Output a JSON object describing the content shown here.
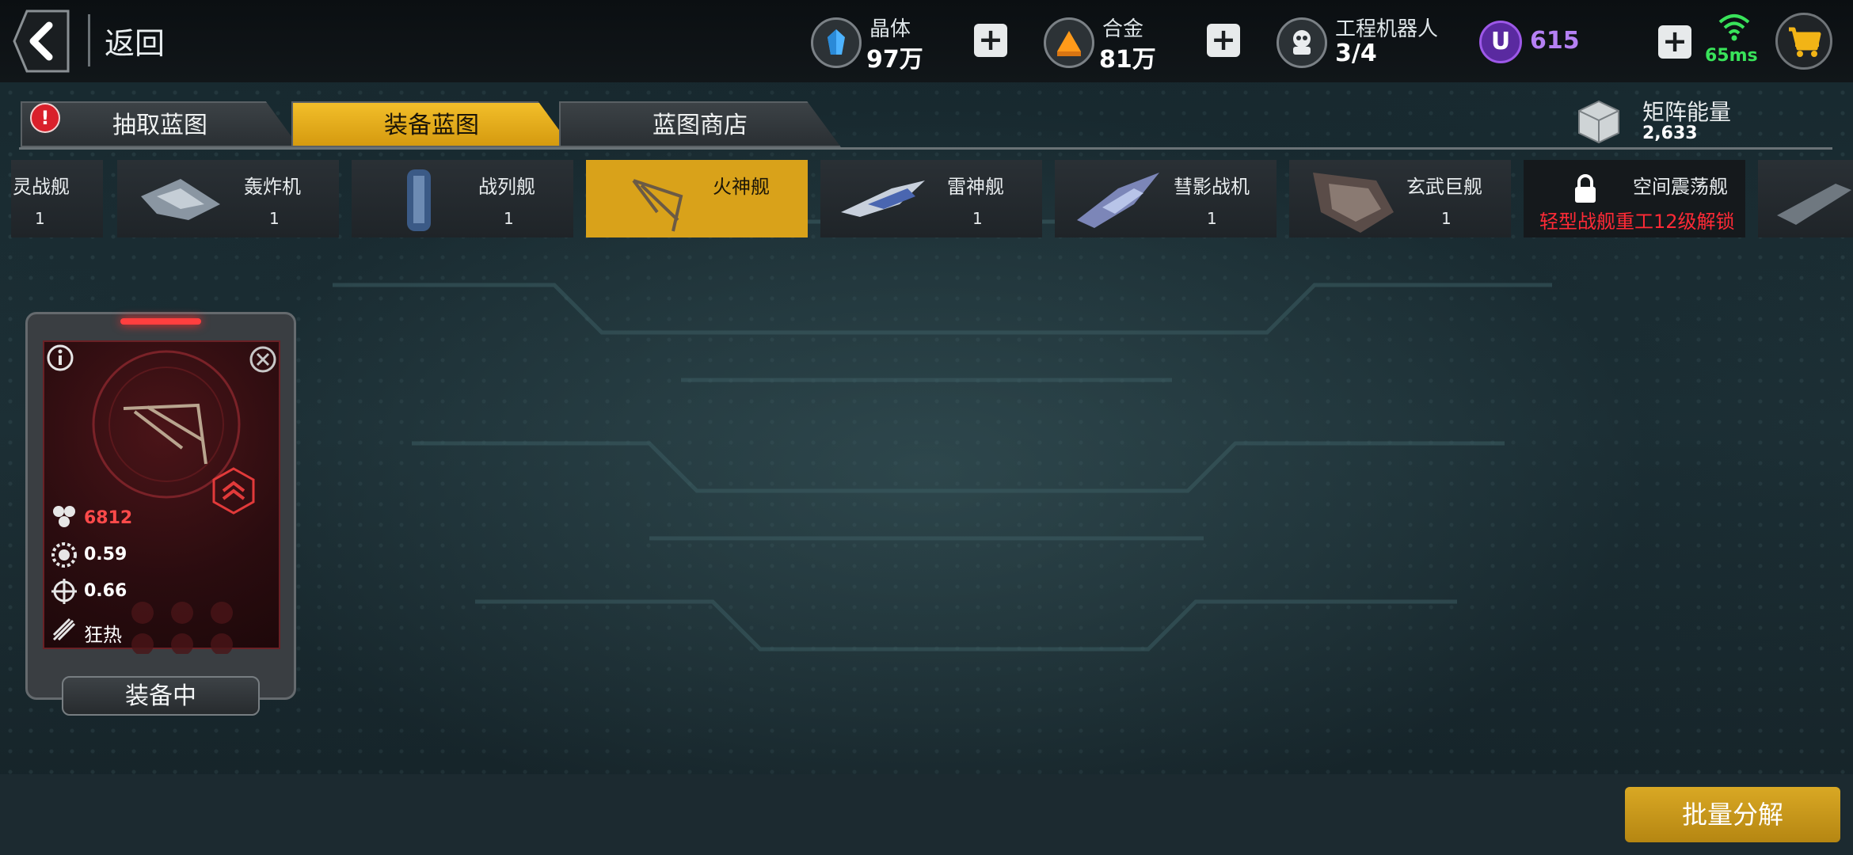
{
  "header": {
    "back_label": "返回",
    "resources": [
      {
        "name": "晶体",
        "value": "97万",
        "icon": "crystal-icon",
        "color": "#4db3ff"
      },
      {
        "name": "合金",
        "value": "81万",
        "icon": "alloy-icon",
        "color": "#ff9a1a"
      },
      {
        "name": "工程机器人",
        "value": "3/4",
        "icon": "robot-icon"
      }
    ],
    "premium": {
      "icon_letter": "U",
      "value": "615",
      "color": "#b580f4"
    },
    "ping": "65ms"
  },
  "tabs": [
    {
      "label": "抽取蓝图",
      "active": false,
      "badge": "!"
    },
    {
      "label": "装备蓝图",
      "active": true
    },
    {
      "label": "蓝图商店",
      "active": false
    }
  ],
  "matrix_energy": {
    "label": "矩阵能量",
    "value": "2,633"
  },
  "ships": [
    {
      "name": "幽灵战舰",
      "count": "1",
      "shown": "灵战舰"
    },
    {
      "name": "轰炸机",
      "count": "1"
    },
    {
      "name": "战列舰",
      "count": "1"
    },
    {
      "name": "火神舰",
      "count": "",
      "active": true
    },
    {
      "name": "雷神舰",
      "count": "1"
    },
    {
      "name": "彗影战机",
      "count": "1"
    },
    {
      "name": "玄武巨舰",
      "count": "1"
    },
    {
      "name": "空间震荡舰",
      "count": "",
      "locked": true,
      "lock_text": "轻型战舰重工12级解锁"
    }
  ],
  "blueprint_card": {
    "stats": [
      {
        "icon": "hexagon-cluster-icon",
        "value": "6812",
        "color": "#ff4a4a"
      },
      {
        "icon": "gear-ring-icon",
        "value": "0.59"
      },
      {
        "icon": "crosshair-icon",
        "value": "0.66"
      },
      {
        "icon": "missile-icon",
        "value": "狂热"
      }
    ],
    "status_button": "装备中"
  },
  "batch_button": "批量分解"
}
